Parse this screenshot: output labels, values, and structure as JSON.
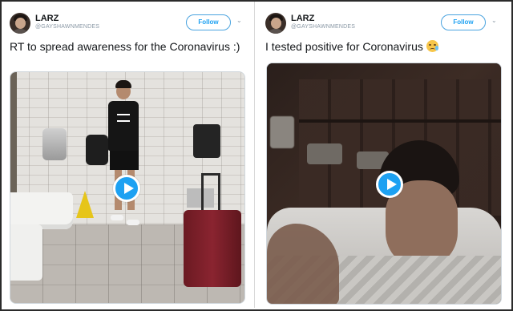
{
  "tweets": [
    {
      "display_name": "LARZ",
      "handle": "@GAYSHAWNMENDES",
      "follow_label": "Follow",
      "chevron": "⌄",
      "text": "RT to spread awareness for the Coronavirus :)",
      "media": {
        "type": "video",
        "play_icon": "play-icon"
      }
    },
    {
      "display_name": "LARZ",
      "handle": "@GAYSHAWNMENDES",
      "follow_label": "Follow",
      "chevron": "⌄",
      "text": "I tested positive for Coronavirus",
      "emoji": "crying-face-emoji",
      "media": {
        "type": "video",
        "play_icon": "play-icon"
      }
    }
  ],
  "colors": {
    "accent": "#1da1f2",
    "handle_gray": "#8a98a5",
    "text": "#14171a"
  }
}
